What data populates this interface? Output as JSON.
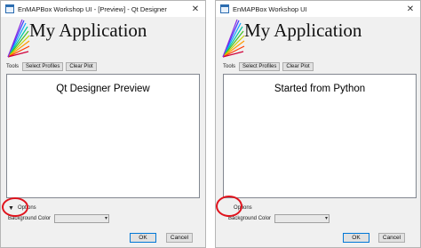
{
  "left_window": {
    "title": "EnMAPBox Workshop UI - [Preview] - Qt Designer",
    "close_glyph": "✕",
    "heading": "My Application",
    "tools_label": "Tools",
    "buttons": [
      "Select Profiles",
      "Clear Plot"
    ],
    "canvas_text": "Qt Designer Preview",
    "options_arrow": "▼",
    "options_label": "Options",
    "background_color_label": "Background Color",
    "ok_label": "OK",
    "cancel_label": "Cancel"
  },
  "right_window": {
    "title": "EnMAPBox Workshop UI",
    "close_glyph": "✕",
    "heading": "My Application",
    "tools_label": "Tools",
    "buttons": [
      "Select Profiles",
      "Clear Plot"
    ],
    "canvas_text": "Started from Python",
    "options_label": "Options",
    "background_color_label": "Background Color",
    "ok_label": "OK",
    "cancel_label": "Cancel"
  },
  "colors": {
    "highlight_ring": "#e0131d",
    "window_bg": "#f0f0f0",
    "canvas_bg": "#ffffff"
  },
  "icons": [
    "app-window-icon",
    "spectral-fan-logo-icon",
    "close-icon",
    "triangle-down-icon",
    "chevron-down-icon"
  ]
}
